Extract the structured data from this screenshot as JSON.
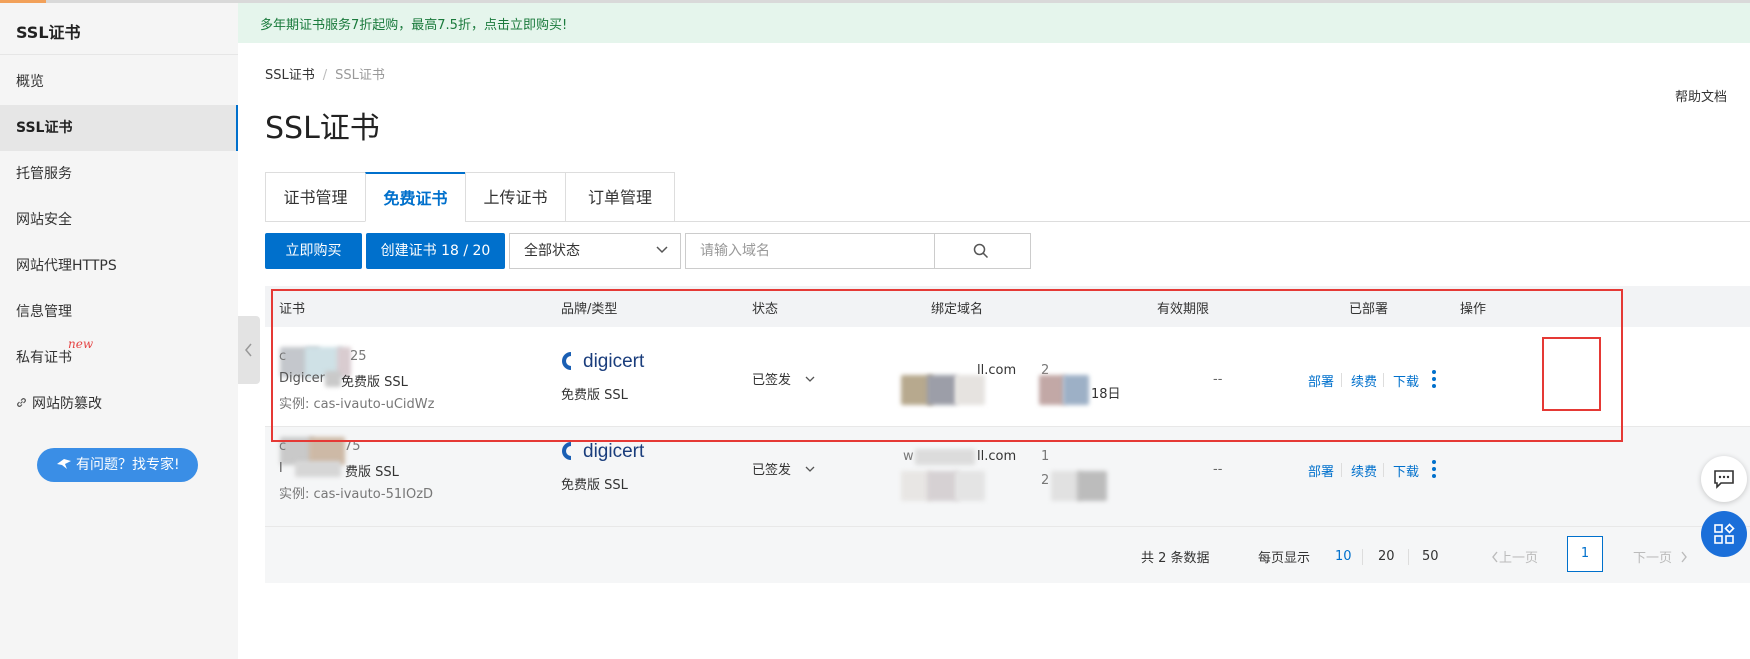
{
  "sidebar": {
    "title": "SSL证书",
    "items": [
      {
        "label": "概览"
      },
      {
        "label": "SSL证书"
      },
      {
        "label": "托管服务"
      },
      {
        "label": "网站安全"
      },
      {
        "label": "网站代理HTTPS"
      },
      {
        "label": "信息管理"
      },
      {
        "label": "私有证书",
        "tag": "new"
      },
      {
        "label": "网站防篡改"
      }
    ],
    "help_button": "有问题？找专家!"
  },
  "banner": {
    "text": "多年期证书服务7折起购，最高7.5折，点击立即购买!"
  },
  "breadcrumb": [
    "SSL证书",
    "SSL证书"
  ],
  "help_doc": "帮助文档",
  "page_title": "SSL证书",
  "tabs": [
    {
      "label": "证书管理"
    },
    {
      "label": "免费证书",
      "active": true
    },
    {
      "label": "上传证书"
    },
    {
      "label": "订单管理"
    }
  ],
  "toolbar": {
    "buy_label": "立即购买",
    "create_label": "创建证书 18 / 20",
    "status_select": "全部状态",
    "search_placeholder": "请输入域名"
  },
  "table": {
    "headers": [
      "证书",
      "品牌/类型",
      "状态",
      "绑定域名",
      "有效期限",
      "已部署",
      "操作"
    ],
    "rows": [
      {
        "cert_name_partial": "c",
        "cert_name_suffix": "25",
        "cert_type_prefix": "Digicer",
        "cert_type": "免费版 SSL",
        "instance": "实例: cas-ivauto-uCidWz",
        "brand": "digicert",
        "brand_type": "免费版 SSL",
        "status": "已签发",
        "domain_suffix": "ll.com",
        "validity_suffix": "18日",
        "validity_prefix": "2",
        "deployed": "--",
        "ops": [
          "部署",
          "续费",
          "下载"
        ]
      },
      {
        "cert_name_partial": "c",
        "cert_name_suffix": "75",
        "cert_type_prefix": "l",
        "cert_type": "费版 SSL",
        "instance": "实例: cas-ivauto-51IOzD",
        "brand": "digicert",
        "brand_type": "免费版 SSL",
        "status": "已签发",
        "domain_prefix": "w",
        "domain_suffix": "ll.com",
        "validity_prefix": "1",
        "validity_prefix2": "2",
        "deployed": "--",
        "ops": [
          "部署",
          "续费",
          "下载"
        ]
      }
    ]
  },
  "pagination": {
    "total": "共 2 条数据",
    "per_page_label": "每页显示",
    "sizes": [
      "10",
      "20",
      "50"
    ],
    "prev": "上一页",
    "page": "1",
    "next": "下一页"
  },
  "colors": {
    "primary": "#0070cc",
    "banner_bg": "#e5f5ec",
    "highlight": "#e53935"
  },
  "icons": [
    "chevron-left-icon",
    "chevron-down-icon",
    "search-icon",
    "link-icon",
    "chat-icon",
    "apps-icon",
    "more-vertical-icon",
    "bird-icon"
  ]
}
